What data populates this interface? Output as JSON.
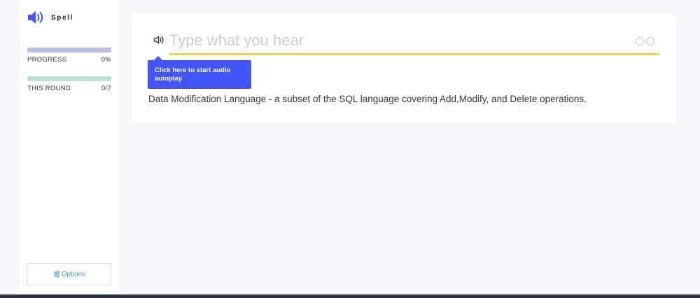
{
  "app": {
    "mode_label": "Spell"
  },
  "sidebar": {
    "progress": {
      "label": "PROGRESS",
      "value": "0%",
      "fraction": 0
    },
    "round": {
      "label": "THIS ROUND",
      "value": "0/7",
      "fraction": 0
    },
    "options_label": "Options"
  },
  "card": {
    "input_placeholder": "Type what you hear",
    "input_value": "",
    "tooltip": "Click here to start audio autoplay",
    "definition": "Data Modification Language - a subset of the SQL language covering Add,Modify, and Delete operations."
  },
  "colors": {
    "brand_accent": "#4255ff",
    "progress_bar": "#b9c1df",
    "round_bar": "#b8e1d3",
    "input_underline": "#f0d35a",
    "options_text": "#4a90b8"
  },
  "icons": {
    "brand": "speaker-icon",
    "audio": "speaker-icon",
    "options": "sliders-icon"
  }
}
